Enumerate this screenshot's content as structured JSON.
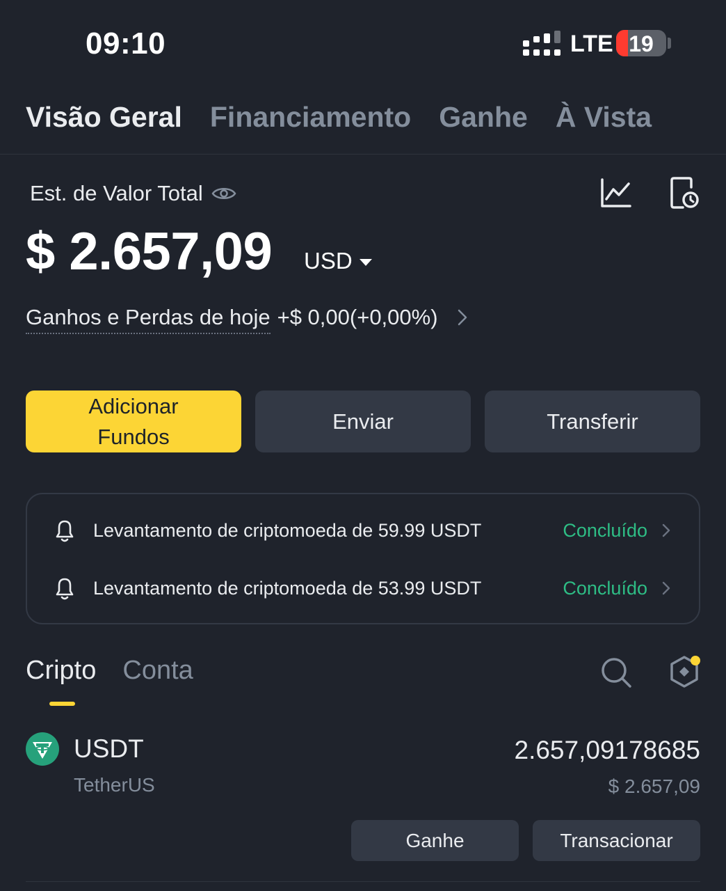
{
  "status_bar": {
    "time": "09:10",
    "network": "LTE",
    "battery": "19"
  },
  "top_tabs": [
    {
      "label": "Visão Geral",
      "active": true
    },
    {
      "label": "Financiamento",
      "active": false
    },
    {
      "label": "Ganhe",
      "active": false
    },
    {
      "label": "À Vista",
      "active": false
    }
  ],
  "header": {
    "est_label": "Est. de Valor Total",
    "total_value": "$ 2.657,09",
    "currency": "USD",
    "pnl_label": "Ganhos e Perdas de hoje",
    "pnl_value": "+$ 0,00(+0,00%)"
  },
  "actions": {
    "add_funds": "Adicionar Fundos",
    "send": "Enviar",
    "transfer": "Transferir"
  },
  "notifications": [
    {
      "text": "Levantamento de criptomoeda de 59.99 USDT",
      "status": "Concluído"
    },
    {
      "text": "Levantamento de criptomoeda de 53.99 USDT",
      "status": "Concluído"
    }
  ],
  "asset_tabs": [
    {
      "label": "Cripto",
      "active": true
    },
    {
      "label": "Conta",
      "active": false
    }
  ],
  "assets": [
    {
      "symbol": "USDT",
      "name": "TetherUS",
      "amount": "2.657,09178685",
      "usd_value": "$ 2.657,09",
      "earn_label": "Ganhe",
      "trade_label": "Transacionar"
    }
  ],
  "colors": {
    "background": "#1f232c",
    "accent_yellow": "#fcd535",
    "success_green": "#2ebd85",
    "muted_text": "#848e9c",
    "button_gray": "#333945",
    "tether_teal": "#26a17b"
  },
  "icons": [
    "signal-icon",
    "battery-icon",
    "eye-icon",
    "chart-icon",
    "history-icon",
    "caret-down-icon",
    "chevron-right-icon",
    "bell-icon",
    "search-icon",
    "settings-hex-icon",
    "tether-icon"
  ]
}
